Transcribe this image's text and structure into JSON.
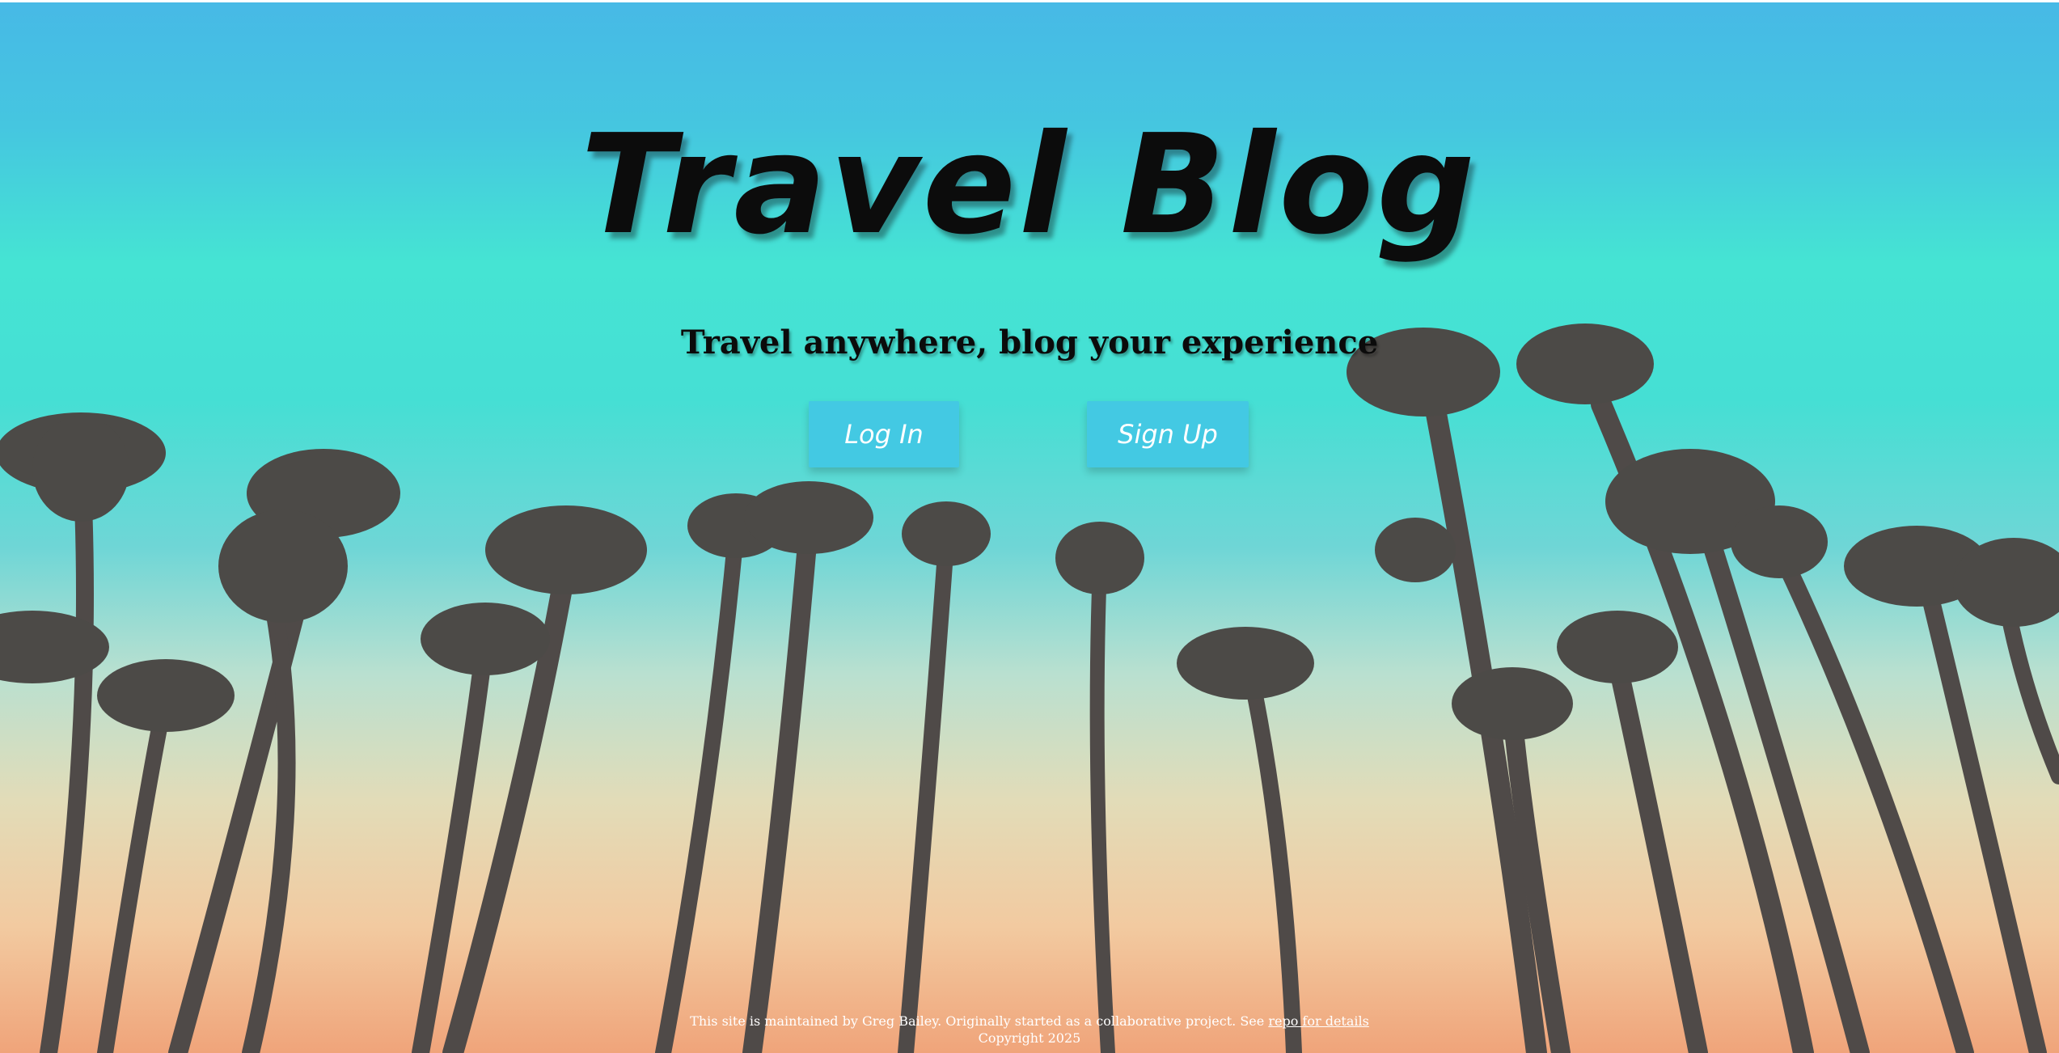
{
  "hero": {
    "title": "Travel Blog",
    "tagline": "Travel anywhere, blog your experience"
  },
  "actions": {
    "login_label": "Log In",
    "signup_label": "Sign Up"
  },
  "footer": {
    "maintained_text": "This site is maintained by Greg Bailey. Originally started as a collaborative project. See ",
    "repo_link_label": "repo for details",
    "copyright": "Copyright 2025"
  },
  "colors": {
    "button_bg": "#43c9e3",
    "button_text": "#ffffff",
    "title_text": "#0c0c0c",
    "sky_top": "#47b9e6",
    "sky_mid": "#45e4d3",
    "sky_bottom": "#f0a47a"
  },
  "background": {
    "image": "palm-trees-sunset-photo"
  }
}
